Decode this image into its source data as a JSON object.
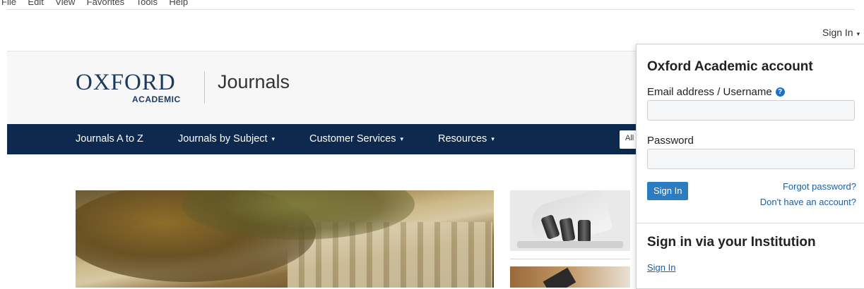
{
  "menubar": {
    "items": [
      "File",
      "Edit",
      "View",
      "Favorites",
      "Tools",
      "Help"
    ]
  },
  "topbar": {
    "signin_label": "Sign In",
    "caret": "▾"
  },
  "header": {
    "logo_main": "OXFORD",
    "logo_sub": "ACADEMIC",
    "section_title": "Journals"
  },
  "nav": {
    "items": [
      {
        "label": "Journals A to Z",
        "has_dropdown": false
      },
      {
        "label": "Journals by Subject",
        "has_dropdown": true
      },
      {
        "label": "Customer Services",
        "has_dropdown": true
      },
      {
        "label": "Resources",
        "has_dropdown": true
      }
    ],
    "caret": "▾",
    "search_scope": "All"
  },
  "signin_panel": {
    "account_heading": "Oxford Academic account",
    "email_label": "Email address / Username",
    "help_icon": "?",
    "email_value": "",
    "password_label": "Password",
    "password_value": "",
    "submit_label": "Sign In",
    "forgot_link": "Forgot password?",
    "register_link": "Don't have an account?",
    "institution_heading": "Sign in via your Institution",
    "institution_link": "Sign In"
  },
  "colors": {
    "nav_bg": "#0d2a4e",
    "brand_navy": "#1c3a5e",
    "button_blue": "#2c7cc1",
    "link_blue": "#1b5fa8"
  }
}
